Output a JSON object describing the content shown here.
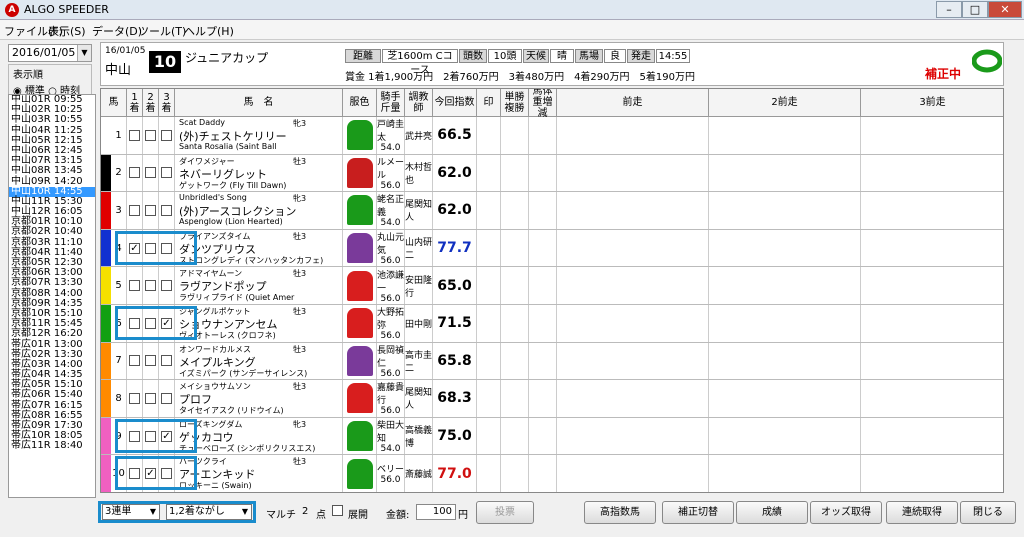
{
  "app": {
    "title": "ALGO SPEEDER",
    "icon": "app-icon"
  },
  "menu": [
    "ファイル(F)",
    "表示(S)",
    "データ(D)",
    "ツール(T)",
    "ヘルプ(H)"
  ],
  "left": {
    "date": "2016/01/05",
    "order_label": "表示順",
    "radio_std": "標準",
    "radio_time": "時刻",
    "races": [
      "中山01R 09:55",
      "中山02R 10:25",
      "中山03R 10:55",
      "中山04R 11:25",
      "中山05R 12:15",
      "中山06R 12:45",
      "中山07R 13:15",
      "中山08R 13:45",
      "中山09R 14:20",
      "中山10R 14:55",
      "中山11R 15:30",
      "中山12R 16:05",
      "京都01R 10:10",
      "京都02R 10:40",
      "京都03R 11:10",
      "京都04R 11:40",
      "京都05R 12:30",
      "京都06R 13:00",
      "京都07R 13:30",
      "京都08R 14:00",
      "京都09R 14:35",
      "京都10R 15:10",
      "京都11R 15:45",
      "京都12R 16:20",
      "帯広01R 13:00",
      "帯広02R 13:30",
      "帯広03R 14:00",
      "帯広04R 14:35",
      "帯広05R 15:10",
      "帯広06R 15:40",
      "帯広07R 16:15",
      "帯広08R 16:55",
      "帯広09R 17:30",
      "帯広10R 18:05",
      "帯広11R 18:40"
    ],
    "selected": 9
  },
  "race": {
    "date": "16/01/05",
    "venue": "中山",
    "no": "10",
    "name": "ジュニアカップ",
    "info": [
      "距離",
      "芝1600m Cコース",
      "頭数",
      "10頭",
      "天候",
      "晴",
      "馬場",
      "良",
      "発走",
      "14:55"
    ],
    "prize": "賞金 1着1,900万円　2着760万円　3着480万円　4着290万円　5着190万円",
    "hosei": "補正中"
  },
  "columns": [
    "馬",
    "1着",
    "2着",
    "3着",
    "馬　名",
    "服色",
    "騎手斤量",
    "調教師",
    "今回指数",
    "印",
    "単勝複勝",
    "馬体重増減",
    "前走",
    "2前走",
    "3前走"
  ],
  "horses": [
    {
      "no": "1",
      "waku": "#ffffff",
      "sire": "Scat Daddy",
      "name": "(外)チェストケリリー",
      "en": "Santa Rosalia (Saint Ball",
      "sex": "牝3",
      "jockey": "戸崎圭太",
      "weight": "54.0",
      "trainer": "武井亮",
      "index": "66.5",
      "idxcolor": "#000",
      "silk": "#1a9a1a",
      "c1": false,
      "c2": false,
      "c3": false
    },
    {
      "no": "2",
      "waku": "#000000",
      "sire": "ダイワメジャー",
      "name": "ネバーリグレット",
      "en": "ゲットワーク (Fly Till Dawn)",
      "sex": "牡3",
      "jockey": "ルメール",
      "weight": "56.0",
      "trainer": "木村哲也",
      "index": "62.0",
      "idxcolor": "#000",
      "silk": "#c81e1e",
      "c1": false,
      "c2": false,
      "c3": false
    },
    {
      "no": "3",
      "waku": "#e00000",
      "sire": "Unbridled's Song",
      "name": "(外)アースコレクション",
      "en": "Aspenglow (Lion Hearted)",
      "sex": "牝3",
      "jockey": "蛯名正義",
      "weight": "54.0",
      "trainer": "尾関知人",
      "index": "62.0",
      "idxcolor": "#000",
      "silk": "#1a9a1a",
      "c1": false,
      "c2": false,
      "c3": false
    },
    {
      "no": "4",
      "waku": "#1030d0",
      "sire": "ブライアンズタイム",
      "name": "ダンツプリウス",
      "en": "ストロングレディ (マンハッタンカフェ)",
      "sex": "牡3",
      "jockey": "丸山元気",
      "weight": "56.0",
      "trainer": "山内研二",
      "index": "77.7",
      "idxcolor": "#1030c0",
      "silk": "#7a3a9a",
      "c1": true,
      "c2": false,
      "c3": false
    },
    {
      "no": "5",
      "waku": "#f5e000",
      "sire": "アドマイヤムーン",
      "name": "ラヴアンドポップ",
      "en": "ラヴリィプライド (Quiet Amer",
      "sex": "牡3",
      "jockey": "池添謙一",
      "weight": "56.0",
      "trainer": "安田隆行",
      "index": "65.0",
      "idxcolor": "#000",
      "silk": "#d81e1e",
      "c1": false,
      "c2": false,
      "c3": false
    },
    {
      "no": "6",
      "waku": "#12a012",
      "sire": "ジャングルポケット",
      "name": "ショウナンアンセム",
      "en": "ヴィオトーレス (クロフネ)",
      "sex": "牡3",
      "jockey": "大野拓弥",
      "weight": "56.0",
      "trainer": "田中剛",
      "index": "71.5",
      "idxcolor": "#000",
      "silk": "#d81e1e",
      "c1": false,
      "c2": false,
      "c3": true
    },
    {
      "no": "7",
      "waku": "#ff8a00",
      "sire": "オンワードカルメス",
      "name": "メイプルキング",
      "en": "イズミパーク (サンデーサイレンス)",
      "sex": "牡3",
      "jockey": "長岡禎仁",
      "weight": "56.0",
      "trainer": "高市圭二",
      "index": "65.8",
      "idxcolor": "#000",
      "silk": "#7a3a9a",
      "c1": false,
      "c2": false,
      "c3": false
    },
    {
      "no": "8",
      "waku": "#ff8a00",
      "sire": "メイショウサムソン",
      "name": "プロフ",
      "en": "タイセイアスク (リドウイム)",
      "sex": "牡3",
      "jockey": "嘉藤貴行",
      "weight": "56.0",
      "trainer": "尾関知人",
      "index": "68.3",
      "idxcolor": "#000",
      "silk": "#d81e1e",
      "c1": false,
      "c2": false,
      "c3": false
    },
    {
      "no": "9",
      "waku": "#f060c0",
      "sire": "ローズキングダム",
      "name": "ゲッカコウ",
      "en": "チューベローズ (シンボリクリスエス)",
      "sex": "牝3",
      "jockey": "柴田大知",
      "weight": "54.0",
      "trainer": "高橋義博",
      "index": "75.0",
      "idxcolor": "#000",
      "silk": "#1a9a1a",
      "c1": false,
      "c2": false,
      "c3": true
    },
    {
      "no": "10",
      "waku": "#f060c0",
      "sire": "ハーツクライ",
      "name": "アーエンキッド",
      "en": "ロッキーニ (Swain)",
      "sex": "牡3",
      "jockey": "ベリー",
      "weight": "56.0",
      "trainer": "斎藤誠",
      "index": "77.0",
      "idxcolor": "#d01010",
      "silk": "#1a9a1a",
      "c1": false,
      "c2": true,
      "c3": false
    }
  ],
  "bottom": {
    "bettype": "3連単",
    "method": "1,2着ながし",
    "multi": "マルチ",
    "points": "2",
    "points_unit": "点",
    "expand": "展開",
    "amount_label": "金額:",
    "amount": "100",
    "yen": "円",
    "buy": "投票",
    "buttons": [
      "高指数馬",
      "補正切替",
      "成績",
      "オッズ取得",
      "連続取得",
      "閉じる"
    ]
  }
}
